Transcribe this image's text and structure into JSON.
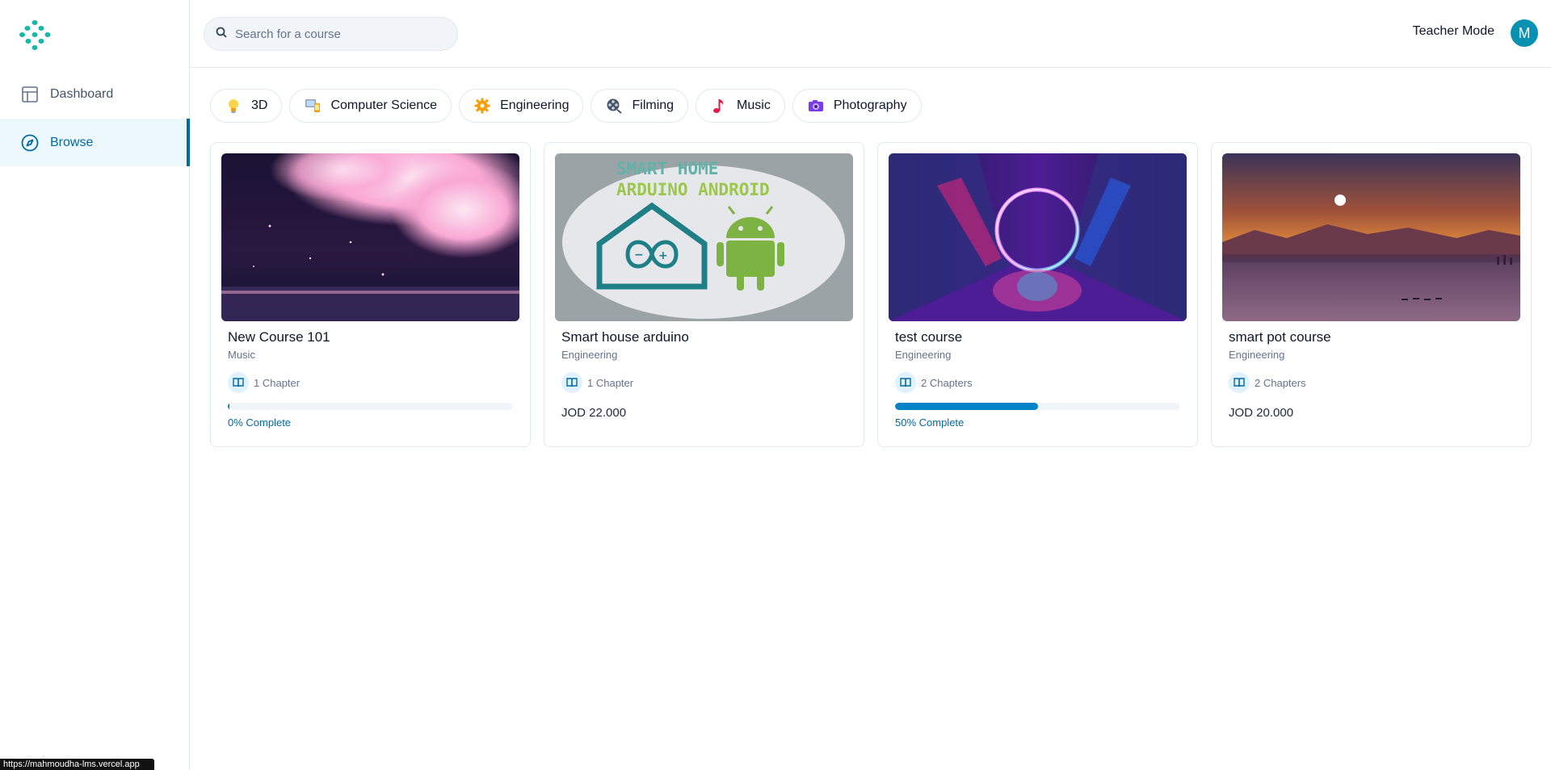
{
  "nav": {
    "items": [
      {
        "label": "Dashboard",
        "icon": "layout-icon",
        "active": false
      },
      {
        "label": "Browse",
        "icon": "compass-icon",
        "active": true
      }
    ]
  },
  "search": {
    "placeholder": "Search for a course",
    "value": ""
  },
  "header": {
    "teacher_mode_label": "Teacher Mode",
    "avatar_initial": "M"
  },
  "categories": [
    {
      "label": "3D",
      "icon": "lightbulb-icon"
    },
    {
      "label": "Computer Science",
      "icon": "computer-icon"
    },
    {
      "label": "Engineering",
      "icon": "gear-icon"
    },
    {
      "label": "Filming",
      "icon": "film-reel-icon"
    },
    {
      "label": "Music",
      "icon": "music-note-icon"
    },
    {
      "label": "Photography",
      "icon": "camera-icon"
    }
  ],
  "courses": [
    {
      "title": "New Course 101",
      "category": "Music",
      "chapters": "1 Chapter",
      "progress": 0,
      "progress_label": "0% Complete",
      "price": null,
      "image": "cherry-blossom-night"
    },
    {
      "title": "Smart house arduino",
      "category": "Engineering",
      "chapters": "1 Chapter",
      "progress": null,
      "progress_label": null,
      "price": "JOD 22.000",
      "image": "smart-home-arduino-android",
      "image_text": [
        "SMART HOME",
        "ARDUINO ANDROID"
      ]
    },
    {
      "title": "test course",
      "category": "Engineering",
      "chapters": "2 Chapters",
      "progress": 50,
      "progress_label": "50% Complete",
      "price": null,
      "image": "neon-ring"
    },
    {
      "title": "smart pot course",
      "category": "Engineering",
      "chapters": "2 Chapters",
      "progress": null,
      "progress_label": null,
      "price": "JOD 20.000",
      "image": "sunset-lake"
    }
  ],
  "status_bar": {
    "url": "https://mahmoudha-lms.vercel.app"
  },
  "colors": {
    "accent": "#0369a1",
    "progress_fill": "#0284c7",
    "avatar": "#0891b2",
    "logo": "#14b8a6"
  }
}
